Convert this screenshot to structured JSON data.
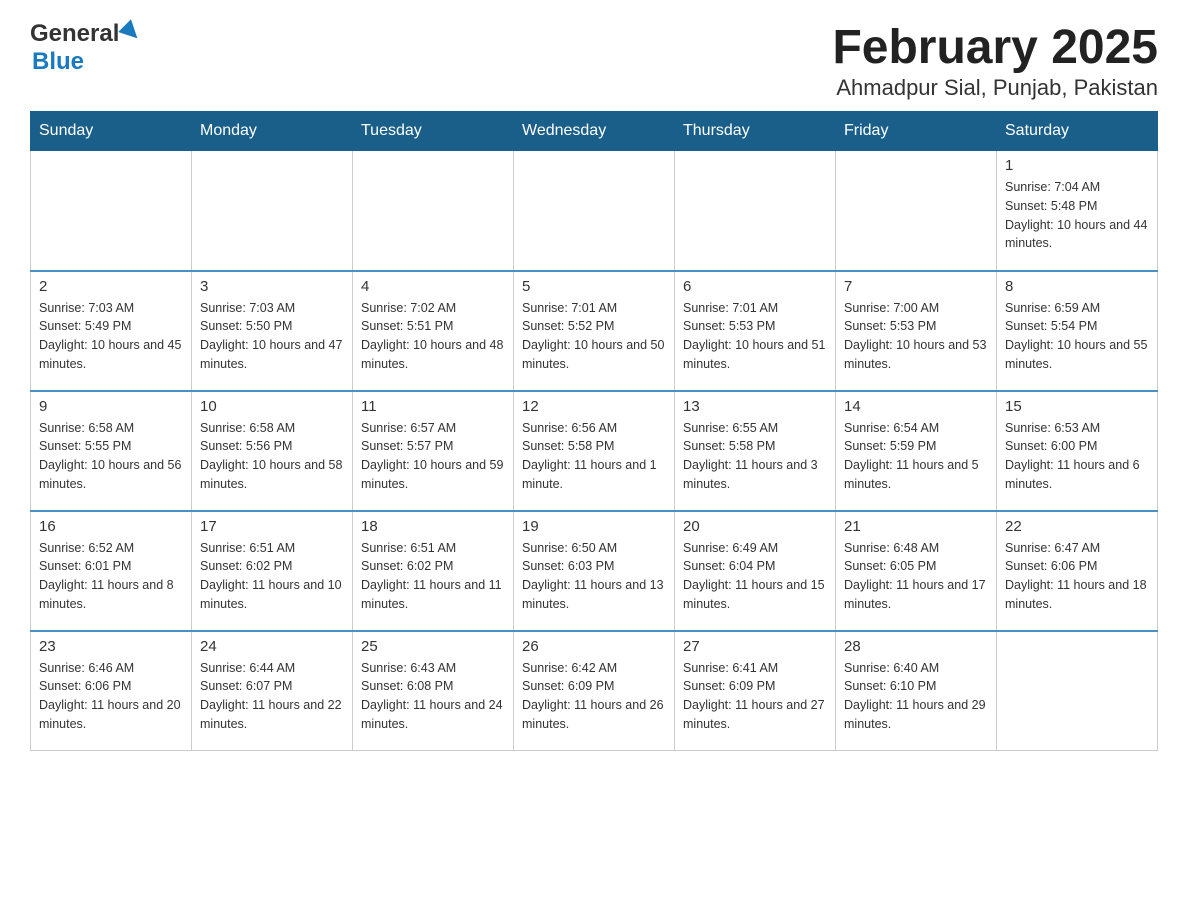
{
  "header": {
    "month_title": "February 2025",
    "location": "Ahmadpur Sial, Punjab, Pakistan",
    "logo_general": "General",
    "logo_blue": "Blue"
  },
  "weekdays": [
    "Sunday",
    "Monday",
    "Tuesday",
    "Wednesday",
    "Thursday",
    "Friday",
    "Saturday"
  ],
  "weeks": [
    [
      {
        "day": "",
        "sunrise": "",
        "sunset": "",
        "daylight": ""
      },
      {
        "day": "",
        "sunrise": "",
        "sunset": "",
        "daylight": ""
      },
      {
        "day": "",
        "sunrise": "",
        "sunset": "",
        "daylight": ""
      },
      {
        "day": "",
        "sunrise": "",
        "sunset": "",
        "daylight": ""
      },
      {
        "day": "",
        "sunrise": "",
        "sunset": "",
        "daylight": ""
      },
      {
        "day": "",
        "sunrise": "",
        "sunset": "",
        "daylight": ""
      },
      {
        "day": "1",
        "sunrise": "Sunrise: 7:04 AM",
        "sunset": "Sunset: 5:48 PM",
        "daylight": "Daylight: 10 hours and 44 minutes."
      }
    ],
    [
      {
        "day": "2",
        "sunrise": "Sunrise: 7:03 AM",
        "sunset": "Sunset: 5:49 PM",
        "daylight": "Daylight: 10 hours and 45 minutes."
      },
      {
        "day": "3",
        "sunrise": "Sunrise: 7:03 AM",
        "sunset": "Sunset: 5:50 PM",
        "daylight": "Daylight: 10 hours and 47 minutes."
      },
      {
        "day": "4",
        "sunrise": "Sunrise: 7:02 AM",
        "sunset": "Sunset: 5:51 PM",
        "daylight": "Daylight: 10 hours and 48 minutes."
      },
      {
        "day": "5",
        "sunrise": "Sunrise: 7:01 AM",
        "sunset": "Sunset: 5:52 PM",
        "daylight": "Daylight: 10 hours and 50 minutes."
      },
      {
        "day": "6",
        "sunrise": "Sunrise: 7:01 AM",
        "sunset": "Sunset: 5:53 PM",
        "daylight": "Daylight: 10 hours and 51 minutes."
      },
      {
        "day": "7",
        "sunrise": "Sunrise: 7:00 AM",
        "sunset": "Sunset: 5:53 PM",
        "daylight": "Daylight: 10 hours and 53 minutes."
      },
      {
        "day": "8",
        "sunrise": "Sunrise: 6:59 AM",
        "sunset": "Sunset: 5:54 PM",
        "daylight": "Daylight: 10 hours and 55 minutes."
      }
    ],
    [
      {
        "day": "9",
        "sunrise": "Sunrise: 6:58 AM",
        "sunset": "Sunset: 5:55 PM",
        "daylight": "Daylight: 10 hours and 56 minutes."
      },
      {
        "day": "10",
        "sunrise": "Sunrise: 6:58 AM",
        "sunset": "Sunset: 5:56 PM",
        "daylight": "Daylight: 10 hours and 58 minutes."
      },
      {
        "day": "11",
        "sunrise": "Sunrise: 6:57 AM",
        "sunset": "Sunset: 5:57 PM",
        "daylight": "Daylight: 10 hours and 59 minutes."
      },
      {
        "day": "12",
        "sunrise": "Sunrise: 6:56 AM",
        "sunset": "Sunset: 5:58 PM",
        "daylight": "Daylight: 11 hours and 1 minute."
      },
      {
        "day": "13",
        "sunrise": "Sunrise: 6:55 AM",
        "sunset": "Sunset: 5:58 PM",
        "daylight": "Daylight: 11 hours and 3 minutes."
      },
      {
        "day": "14",
        "sunrise": "Sunrise: 6:54 AM",
        "sunset": "Sunset: 5:59 PM",
        "daylight": "Daylight: 11 hours and 5 minutes."
      },
      {
        "day": "15",
        "sunrise": "Sunrise: 6:53 AM",
        "sunset": "Sunset: 6:00 PM",
        "daylight": "Daylight: 11 hours and 6 minutes."
      }
    ],
    [
      {
        "day": "16",
        "sunrise": "Sunrise: 6:52 AM",
        "sunset": "Sunset: 6:01 PM",
        "daylight": "Daylight: 11 hours and 8 minutes."
      },
      {
        "day": "17",
        "sunrise": "Sunrise: 6:51 AM",
        "sunset": "Sunset: 6:02 PM",
        "daylight": "Daylight: 11 hours and 10 minutes."
      },
      {
        "day": "18",
        "sunrise": "Sunrise: 6:51 AM",
        "sunset": "Sunset: 6:02 PM",
        "daylight": "Daylight: 11 hours and 11 minutes."
      },
      {
        "day": "19",
        "sunrise": "Sunrise: 6:50 AM",
        "sunset": "Sunset: 6:03 PM",
        "daylight": "Daylight: 11 hours and 13 minutes."
      },
      {
        "day": "20",
        "sunrise": "Sunrise: 6:49 AM",
        "sunset": "Sunset: 6:04 PM",
        "daylight": "Daylight: 11 hours and 15 minutes."
      },
      {
        "day": "21",
        "sunrise": "Sunrise: 6:48 AM",
        "sunset": "Sunset: 6:05 PM",
        "daylight": "Daylight: 11 hours and 17 minutes."
      },
      {
        "day": "22",
        "sunrise": "Sunrise: 6:47 AM",
        "sunset": "Sunset: 6:06 PM",
        "daylight": "Daylight: 11 hours and 18 minutes."
      }
    ],
    [
      {
        "day": "23",
        "sunrise": "Sunrise: 6:46 AM",
        "sunset": "Sunset: 6:06 PM",
        "daylight": "Daylight: 11 hours and 20 minutes."
      },
      {
        "day": "24",
        "sunrise": "Sunrise: 6:44 AM",
        "sunset": "Sunset: 6:07 PM",
        "daylight": "Daylight: 11 hours and 22 minutes."
      },
      {
        "day": "25",
        "sunrise": "Sunrise: 6:43 AM",
        "sunset": "Sunset: 6:08 PM",
        "daylight": "Daylight: 11 hours and 24 minutes."
      },
      {
        "day": "26",
        "sunrise": "Sunrise: 6:42 AM",
        "sunset": "Sunset: 6:09 PM",
        "daylight": "Daylight: 11 hours and 26 minutes."
      },
      {
        "day": "27",
        "sunrise": "Sunrise: 6:41 AM",
        "sunset": "Sunset: 6:09 PM",
        "daylight": "Daylight: 11 hours and 27 minutes."
      },
      {
        "day": "28",
        "sunrise": "Sunrise: 6:40 AM",
        "sunset": "Sunset: 6:10 PM",
        "daylight": "Daylight: 11 hours and 29 minutes."
      },
      {
        "day": "",
        "sunrise": "",
        "sunset": "",
        "daylight": ""
      }
    ]
  ]
}
